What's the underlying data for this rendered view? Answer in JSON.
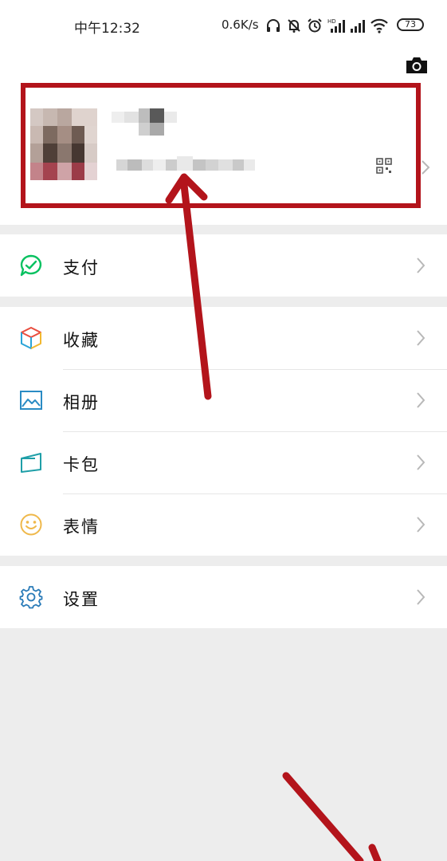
{
  "status_bar": {
    "time": "中午12:32",
    "network_speed": "0.6K/s",
    "battery": "73",
    "icons": [
      "headphones-icon",
      "bell-off-icon",
      "alarm-icon",
      "hd-signal-icon",
      "signal-icon",
      "wifi-icon",
      "battery-icon"
    ]
  },
  "header": {
    "camera_icon": "camera-icon",
    "qr_icon": "qr-code-icon"
  },
  "menu": {
    "pay": {
      "label": "支付",
      "icon": "wechat-pay-icon"
    },
    "favorites": {
      "label": "收藏",
      "icon": "cube-icon"
    },
    "album": {
      "label": "相册",
      "icon": "image-icon"
    },
    "cards": {
      "label": "卡包",
      "icon": "card-icon"
    },
    "stickers": {
      "label": "表情",
      "icon": "smiley-icon"
    },
    "settings": {
      "label": "设置",
      "icon": "gear-icon"
    }
  },
  "colors": {
    "annotation": "#b3141b",
    "accent_green": "#07c160",
    "page_bg": "#ededed"
  }
}
